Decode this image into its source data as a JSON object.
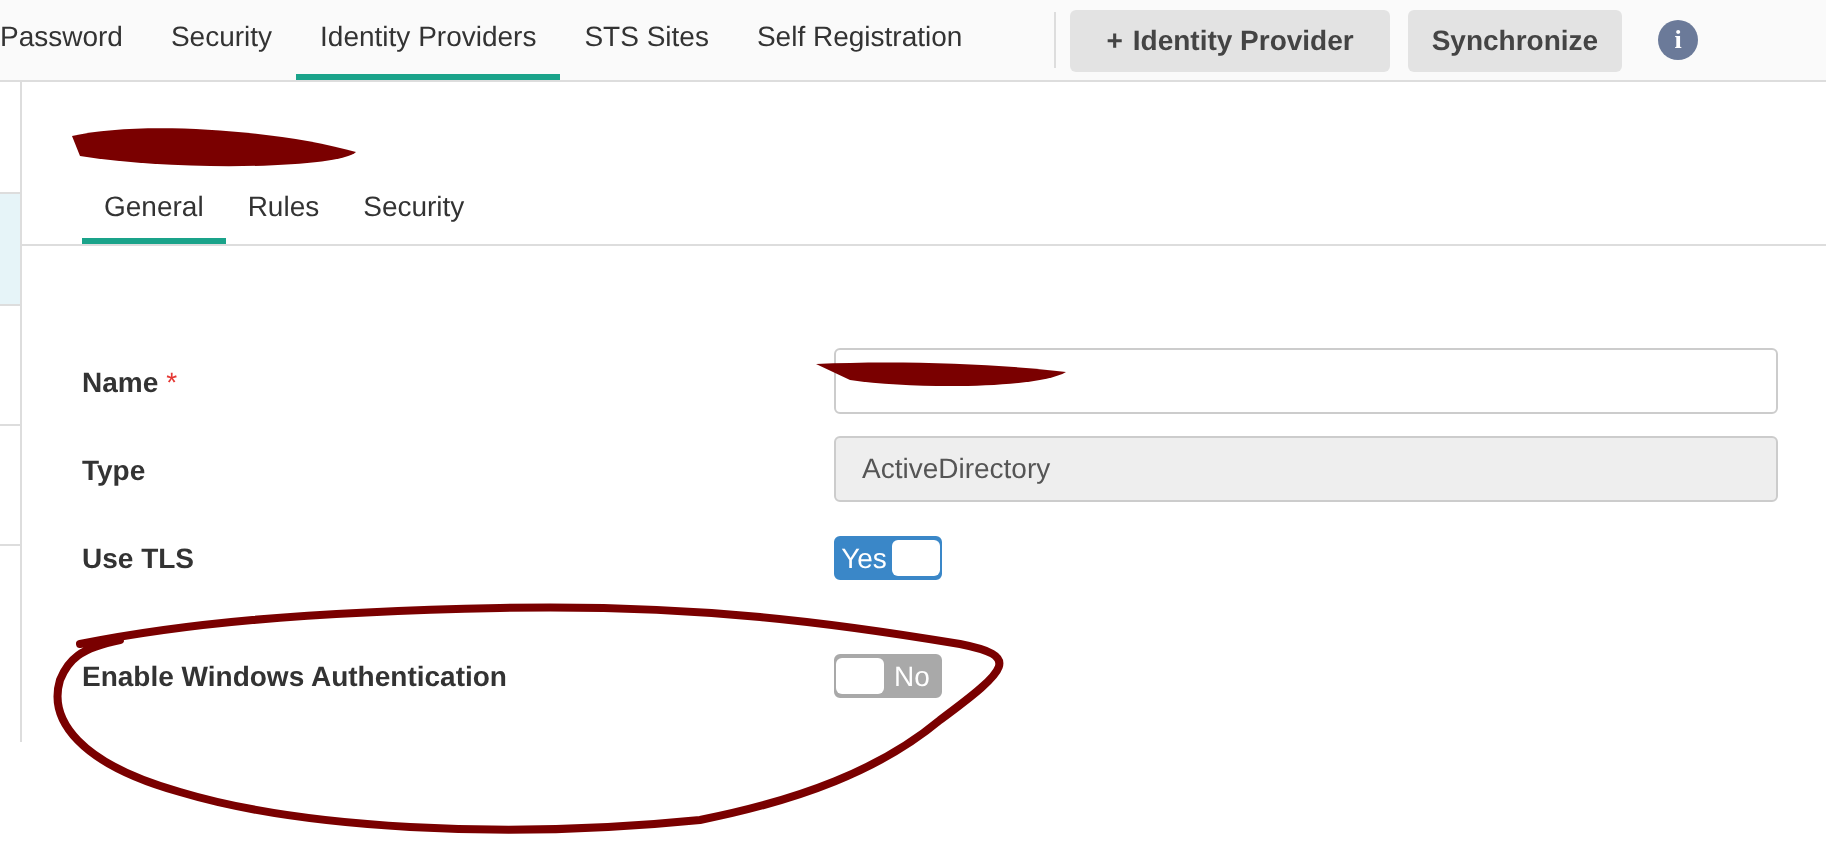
{
  "top_tabs": [
    {
      "label": "Password",
      "selected": false
    },
    {
      "label": "Security",
      "selected": false
    },
    {
      "label": "Identity Providers",
      "selected": true
    },
    {
      "label": "STS Sites",
      "selected": false
    },
    {
      "label": "Self Registration",
      "selected": false
    }
  ],
  "toolbar": {
    "add_button": {
      "icon": "+",
      "label": "Identity Provider"
    },
    "sync_button": "Synchronize",
    "info_icon": "i"
  },
  "sub_tabs": [
    {
      "label": "General",
      "selected": true
    },
    {
      "label": "Rules",
      "selected": false
    },
    {
      "label": "Security",
      "selected": false
    }
  ],
  "form": [
    {
      "kind": "text",
      "label": "Name",
      "required_mark": "*"
    },
    {
      "kind": "readonly",
      "label": "Type",
      "value": "ActiveDirectory"
    },
    {
      "kind": "toggle",
      "label": "Use TLS",
      "on": true,
      "text": "Yes"
    },
    {
      "kind": "toggle",
      "label": "Enable Windows Authentication",
      "on": false,
      "text": "No"
    }
  ]
}
